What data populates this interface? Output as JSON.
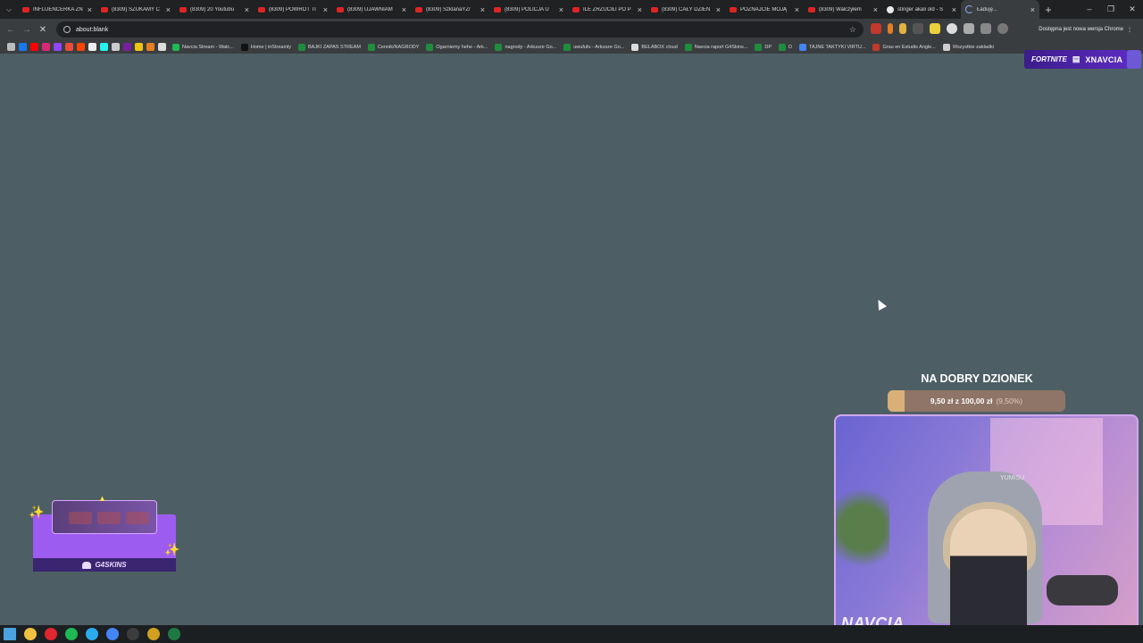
{
  "browser": {
    "tabs": [
      {
        "title": "INFLUENCERKA ZN",
        "favicon": "youtube-icon",
        "active": false
      },
      {
        "title": "(8309) SZUKAMY C",
        "favicon": "youtube-icon",
        "active": false
      },
      {
        "title": "(8309) 20 Youtubu",
        "favicon": "youtube-icon",
        "active": false
      },
      {
        "title": "(8309) POWRÓT TI",
        "favicon": "youtube-icon",
        "active": false
      },
      {
        "title": "(8309) UJAWNIAM",
        "favicon": "youtube-icon",
        "active": false
      },
      {
        "title": "(8309) SzklanaYZ/",
        "favicon": "youtube-icon",
        "active": false
      },
      {
        "title": "(8309) POLICJA U",
        "favicon": "youtube-icon",
        "active": false
      },
      {
        "title": "ILE ZRZUCIŁI PO P",
        "favicon": "youtube-icon",
        "active": false
      },
      {
        "title": "(8309) CAŁY DZIEŃ",
        "favicon": "youtube-icon",
        "active": false
      },
      {
        "title": "POZNAJCIE MOJĄ",
        "favicon": "youtube-icon",
        "active": false
      },
      {
        "title": "(8309) Walczyłem",
        "favicon": "youtube-icon",
        "active": false
      },
      {
        "title": "stinger akali old - S",
        "favicon": "google-icon",
        "active": false
      },
      {
        "title": "Ładuję...",
        "favicon": "loading-icon",
        "active": true
      }
    ],
    "address": {
      "url": "about:blank"
    },
    "update_label": "Dostępna jest nowa wersja Chrome",
    "bookmarks": [
      {
        "label": "Navcia Stream - Watc...",
        "color": "#1db954"
      },
      {
        "label": "Home | inStreamly",
        "color": "#111111"
      },
      {
        "label": "BAJKI ZAPAS STREAM",
        "color": "#1e8e3e"
      },
      {
        "label": "Cennik/NAGRODY",
        "color": "#1e8e3e"
      },
      {
        "label": "Ogarniemy hehe - Ark...",
        "color": "#1e8e3e"
      },
      {
        "label": "nagrody - Arkusze Go...",
        "color": "#1e8e3e"
      },
      {
        "label": "uwufufu - Arkusze Go...",
        "color": "#1e8e3e"
      },
      {
        "label": "BELABOX cloud",
        "color": "#dddddd"
      },
      {
        "label": "Navcia raport G4Skins...",
        "color": "#1e8e3e"
      },
      {
        "label": "DP",
        "color": "#1e8e3e"
      },
      {
        "label": "D",
        "color": "#1e8e3e"
      },
      {
        "label": "TAJNE TAKTYKI VIRTU...",
        "color": "#4285f4"
      },
      {
        "label": "Grau en Estudis Angle...",
        "color": "#c0392b"
      },
      {
        "label": "Wszystkie zakładki",
        "color": "#cfcfcf"
      }
    ]
  },
  "overlay": {
    "fortnite": {
      "game": "FORTNITE",
      "platform_icon": "gamepad-icon",
      "name": "XNAVCIA"
    },
    "goal": {
      "title": "NA DOBRY DZIONEK",
      "amount_text": "9,50 zł z 100,00 zł",
      "percent_text": "(9,50%)",
      "progress": 0.095,
      "colors": {
        "fill": "#d8b078",
        "track": "#8f7567"
      }
    },
    "webcam": {
      "streamer_name": "NAVCIA",
      "chair_brand": "YUMISU"
    },
    "sponsor": {
      "logo_text": "G4SKINS"
    }
  },
  "taskbar": {
    "icons": [
      "windows-start-icon",
      "file-explorer-icon",
      "opera-gx-icon",
      "spotify-icon",
      "telegram-icon",
      "chrome-icon",
      "obs-icon",
      "chrome-dev-icon",
      "excel-icon"
    ]
  }
}
